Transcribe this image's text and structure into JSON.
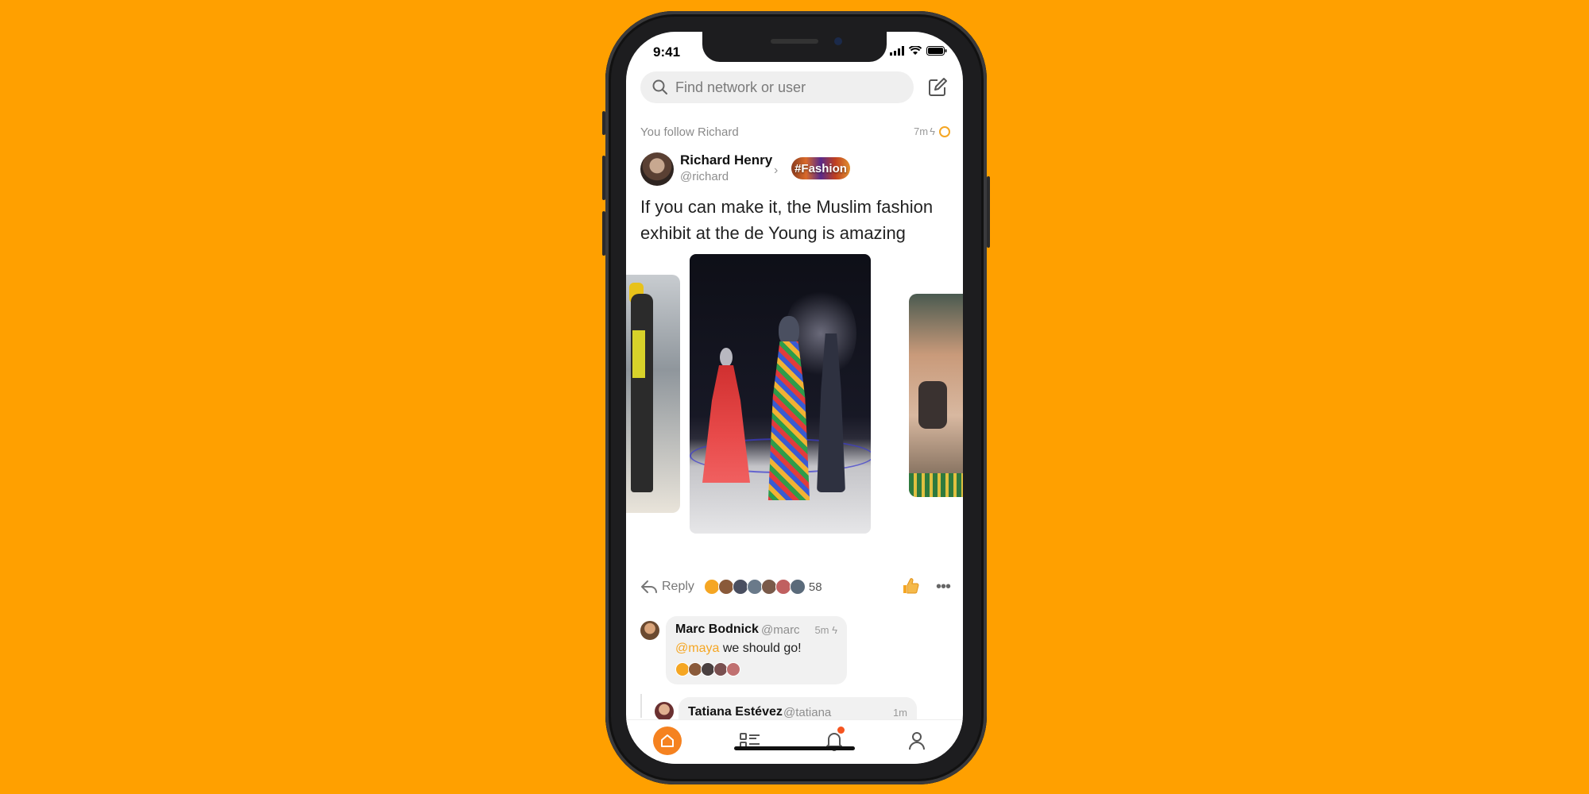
{
  "status_bar": {
    "time": "9:41"
  },
  "search": {
    "placeholder": "Find network or user"
  },
  "feed": {
    "context_line": "You follow Richard",
    "post": {
      "time": "7m",
      "author_name": "Richard Henry",
      "author_handle": "@richard",
      "network_tag": "#Fashion",
      "text": "If you can make it, the Muslim fashion exhibit at the de Young is amazing",
      "reply_label": "Reply",
      "reaction_count": "58",
      "reactor_colors": [
        "#F5A623",
        "#8a5a3a",
        "#4a4f60",
        "#6a7a8a",
        "#7a5a4a",
        "#c06060",
        "#5a6a7a"
      ]
    },
    "comment": {
      "name": "Marc Bodnick",
      "handle": "@marc",
      "time": "5m",
      "mention": "@maya",
      "text": " we should go!",
      "reactor_colors": [
        "#F5A623",
        "#8a5a3a",
        "#4a4040",
        "#7a5050",
        "#c07070"
      ]
    },
    "reply": {
      "name": "Tatiana Estévez",
      "handle": "@tatiana",
      "time": "1m"
    }
  },
  "tabbar": {
    "items": [
      "home-icon",
      "feed-list-icon",
      "notifications-icon",
      "profile-icon"
    ],
    "accent": "#F58220"
  },
  "colors": {
    "background": "#FFA000",
    "accent": "#F5A623"
  }
}
